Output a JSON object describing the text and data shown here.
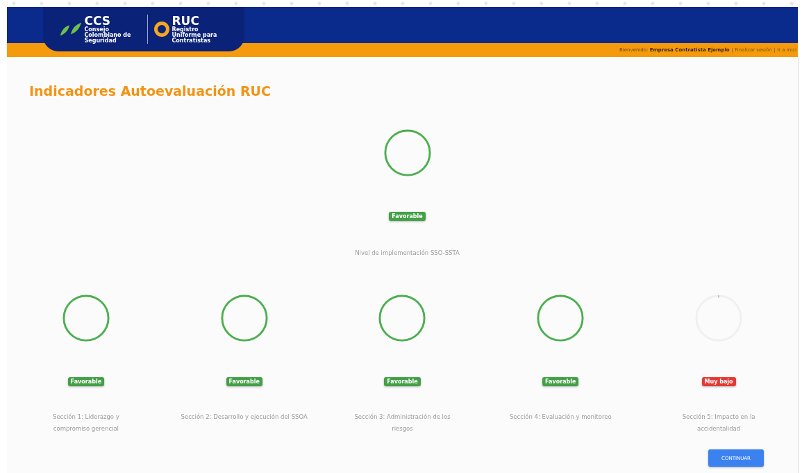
{
  "header": {
    "ccs_logo": {
      "name": "CCS",
      "subtitle": "Consejo Colombiano de Seguridad"
    },
    "ruc_logo": {
      "name": "RUC",
      "subtitle": "Registro Uniforme para Contratistas"
    },
    "welcome_label": "Bienvenido:",
    "company": "Empresa Contratista Ejemplo",
    "links": [
      "| Finalizar sesión",
      "| Ir a inici"
    ]
  },
  "title": "Indicadores Autoevaluación RUC",
  "main_indicator": {
    "status": "Favorable",
    "kind": "favorable",
    "label": "Nivel de implementación SSO-SSTA"
  },
  "sections": [
    {
      "status": "Favorable",
      "kind": "favorable",
      "label": "Sección 1: Liderazgo y compromiso gerencial"
    },
    {
      "status": "Favorable",
      "kind": "favorable",
      "label": "Sección 2: Desarrollo y ejecución del SSOA"
    },
    {
      "status": "Favorable",
      "kind": "favorable",
      "label": "Sección 3: Administración de los riesgos"
    },
    {
      "status": "Favorable",
      "kind": "favorable",
      "label": "Sección 4: Evaluación y monitoreo"
    },
    {
      "status": "Muy bajo",
      "kind": "muy_bajo",
      "label": "Sección 5: Impacto en la accidentalidad"
    }
  ],
  "button": "CONTINUAR"
}
